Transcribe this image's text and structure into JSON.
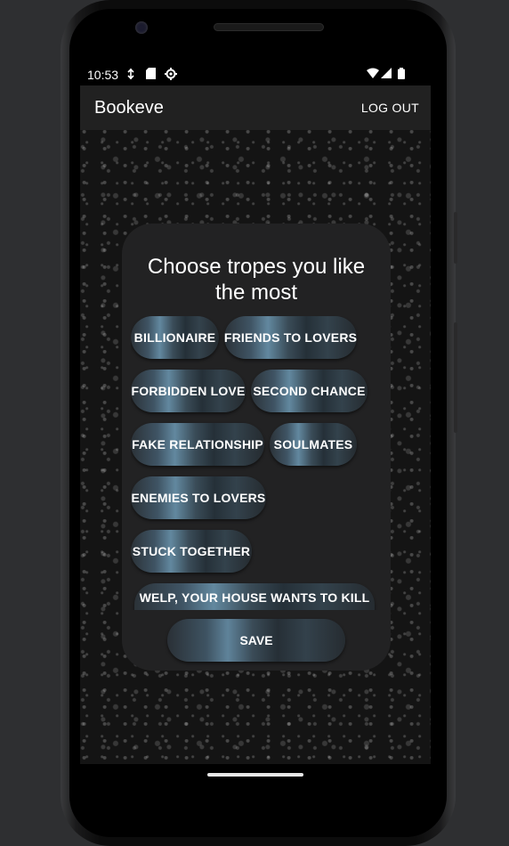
{
  "status_bar": {
    "time": "10:53",
    "left_icons": [
      "usb-debug-icon",
      "sd-card-icon",
      "settings-icon"
    ],
    "right_icons": [
      "wifi-icon",
      "signal-icon",
      "battery-icon"
    ]
  },
  "app_bar": {
    "title": "Bookeve",
    "logout_label": "LOG OUT"
  },
  "card": {
    "heading": "Choose tropes you like the most",
    "tropes": [
      "BILLIONAIRE",
      "FRIENDS TO LOVERS",
      "FORBIDDEN LOVE",
      "SECOND CHANCE",
      "FAKE RELATIONSHIP",
      "SOULMATES",
      "ENEMIES TO LOVERS",
      "STUCK TOGETHER",
      "WELP, YOUR HOUSE WANTS TO KILL YOU"
    ],
    "save_label": "SAVE"
  },
  "colors": {
    "app_bar": "#212121",
    "card": "#222223",
    "chip_accent": "#62889f"
  }
}
